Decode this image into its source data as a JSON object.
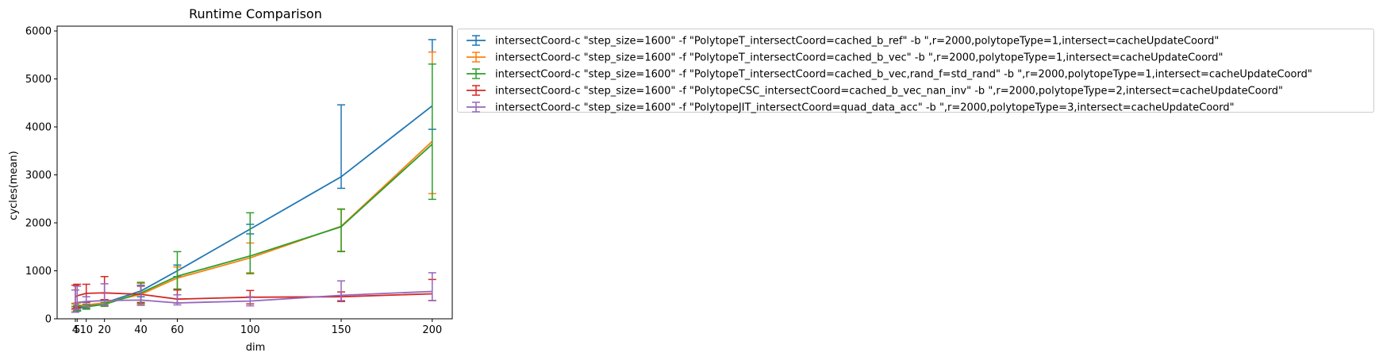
{
  "chart_data": {
    "type": "line",
    "title": "Runtime Comparison",
    "xlabel": "dim",
    "ylabel": "cycles(mean)",
    "xlim": [
      -6,
      211
    ],
    "ylim": [
      0,
      6100
    ],
    "x_ticks": [
      4,
      5,
      10,
      20,
      40,
      60,
      100,
      150,
      200
    ],
    "x_tick_labels": [
      "4",
      "5",
      "10",
      "20",
      "40",
      "60",
      "100",
      "150",
      "200"
    ],
    "y_ticks": [
      0,
      1000,
      2000,
      3000,
      4000,
      5000,
      6000
    ],
    "y_tick_labels": [
      "0",
      "1000",
      "2000",
      "3000",
      "4000",
      "5000",
      "6000"
    ],
    "grid": false,
    "legend_position": "outside upper right",
    "x": [
      4,
      5,
      10,
      20,
      40,
      60,
      100,
      150,
      200
    ],
    "series": [
      {
        "name": "intersectCoord-c \"step_size=1600\" -f \"PolytopeT_intersectCoord=cached_b_ref\" -b \",r=2000,polytopeType=1,intersect=cacheUpdateCoord\"",
        "color": "#1f77b4",
        "values": [
          230,
          240,
          270,
          330,
          580,
          1000,
          1870,
          2960,
          4440
        ],
        "err_low": [
          140,
          170,
          220,
          280,
          460,
          880,
          1770,
          2720,
          3950
        ],
        "err_high": [
          320,
          330,
          340,
          400,
          700,
          1120,
          1970,
          4460,
          5820
        ]
      },
      {
        "name": "intersectCoord-c \"step_size=1600\" -f \"PolytopeT_intersectCoord=cached_b_vec\" -b \",r=2000,polytopeType=1,intersect=cacheUpdateCoord\"",
        "color": "#ff7f0e",
        "values": [
          250,
          270,
          290,
          330,
          510,
          850,
          1270,
          1930,
          3700
        ],
        "err_low": [
          190,
          210,
          240,
          270,
          280,
          620,
          960,
          1410,
          2610
        ],
        "err_high": [
          310,
          330,
          350,
          390,
          740,
          1080,
          1580,
          2280,
          5560
        ]
      },
      {
        "name": "intersectCoord-c \"step_size=1600\" -f \"PolytopeT_intersectCoord=cached_b_vec,rand_f=std_rand\" -b \",r=2000,polytopeType=1,intersect=cacheUpdateCoord\"",
        "color": "#2ca02c",
        "values": [
          200,
          220,
          250,
          300,
          540,
          890,
          1310,
          1920,
          3640
        ],
        "err_low": [
          140,
          160,
          200,
          260,
          320,
          620,
          940,
          1400,
          2490
        ],
        "err_high": [
          260,
          280,
          300,
          340,
          760,
          1400,
          2210,
          2290,
          5310
        ]
      },
      {
        "name": "intersectCoord-c \"step_size=1600\" -f \"PolytopeCSC_intersectCoord=cached_b_vec_nan_inv\" -b \",r=2000,polytopeType=2,intersect=cacheUpdateCoord\"",
        "color": "#d62728",
        "values": [
          460,
          480,
          530,
          540,
          510,
          410,
          450,
          460,
          520
        ],
        "err_low": [
          220,
          240,
          340,
          400,
          340,
          330,
          310,
          360,
          380
        ],
        "err_high": [
          700,
          720,
          720,
          880,
          680,
          600,
          590,
          560,
          820
        ]
      },
      {
        "name": "intersectCoord-c \"step_size=1600\" -f \"PolytopeJIT_intersectCoord=quad_data_acc\" -b \",r=2000,polytopeType=3,intersect=cacheUpdateCoord\"",
        "color": "#9467bd",
        "values": [
          320,
          340,
          360,
          380,
          390,
          330,
          370,
          490,
          570
        ],
        "err_low": [
          140,
          200,
          260,
          290,
          290,
          290,
          270,
          380,
          380
        ],
        "err_high": [
          600,
          680,
          460,
          730,
          690,
          500,
          460,
          790,
          960
        ]
      }
    ]
  }
}
